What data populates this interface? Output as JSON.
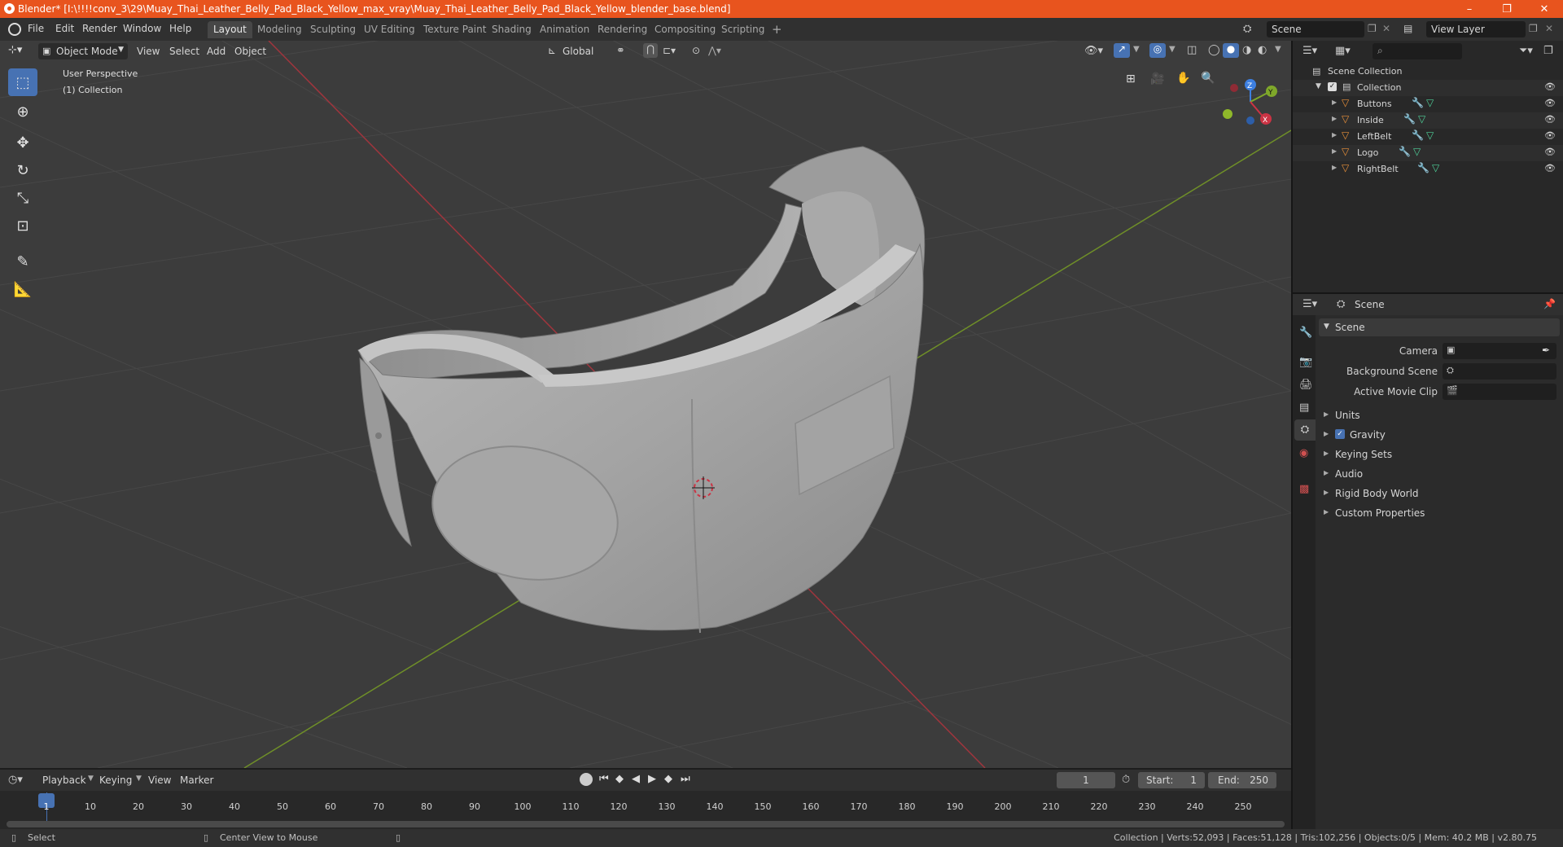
{
  "titlebar": {
    "title": "Blender* [I:\\!!!!conv_3\\29\\Muay_Thai_Leather_Belly_Pad_Black_Yellow_max_vray\\Muay_Thai_Leather_Belly_Pad_Black_Yellow_blender_base.blend]",
    "minimize": "–",
    "restore": "❐",
    "close": "✕"
  },
  "menu": {
    "items": [
      "File",
      "Edit",
      "Render",
      "Window",
      "Help"
    ],
    "workspaces": [
      "Layout",
      "Modeling",
      "Sculpting",
      "UV Editing",
      "Texture Paint",
      "Shading",
      "Animation",
      "Rendering",
      "Compositing",
      "Scripting"
    ],
    "add_workspace": "+",
    "scene_label": "Scene",
    "view_layer_label": "View Layer"
  },
  "viewport_header": {
    "mode": "Object Mode",
    "menus": [
      "View",
      "Select",
      "Add",
      "Object"
    ],
    "orientation": "Global"
  },
  "viewport": {
    "perspective_label": "User Perspective",
    "collection_label": "(1) Collection",
    "gizmo": {
      "x": "X",
      "y": "Y",
      "z": "Z"
    }
  },
  "outliner": {
    "search_placeholder": "",
    "scene_collection": "Scene Collection",
    "collection": "Collection",
    "objects": [
      "Buttons",
      "Inside",
      "LeftBelt",
      "Logo",
      "RightBelt"
    ]
  },
  "properties": {
    "header": "Scene",
    "panel": "Scene",
    "fields": [
      {
        "label": "Camera",
        "value": ""
      },
      {
        "label": "Background Scene",
        "value": ""
      },
      {
        "label": "Active Movie Clip",
        "value": ""
      }
    ],
    "sections": [
      "Units",
      "Gravity",
      "Keying Sets",
      "Audio",
      "Rigid Body World",
      "Custom Properties"
    ],
    "gravity_checked": true
  },
  "timeline": {
    "menus": [
      "Playback",
      "Keying",
      "View",
      "Marker"
    ],
    "current_frame": "1",
    "start_label": "Start:",
    "start": "1",
    "end_label": "End:",
    "end": "250",
    "ticks": [
      "1",
      "10",
      "20",
      "30",
      "40",
      "50",
      "60",
      "70",
      "80",
      "90",
      "100",
      "110",
      "120",
      "130",
      "140",
      "150",
      "160",
      "170",
      "180",
      "190",
      "200",
      "210",
      "220",
      "230",
      "240",
      "250"
    ]
  },
  "statusbar": {
    "left_action": "Select",
    "middle_action": "Center View to Mouse",
    "stats": "Collection | Verts:52,093 | Faces:51,128 | Tris:102,256 | Objects:0/5 | Mem: 40.2 MB | v2.80.75"
  },
  "colors": {
    "titlebar": "#e8541e",
    "active_blue": "#4772b3",
    "axis_x": "#cc3344",
    "axis_y": "#7fa82a",
    "axis_z": "#3d7fe0"
  }
}
